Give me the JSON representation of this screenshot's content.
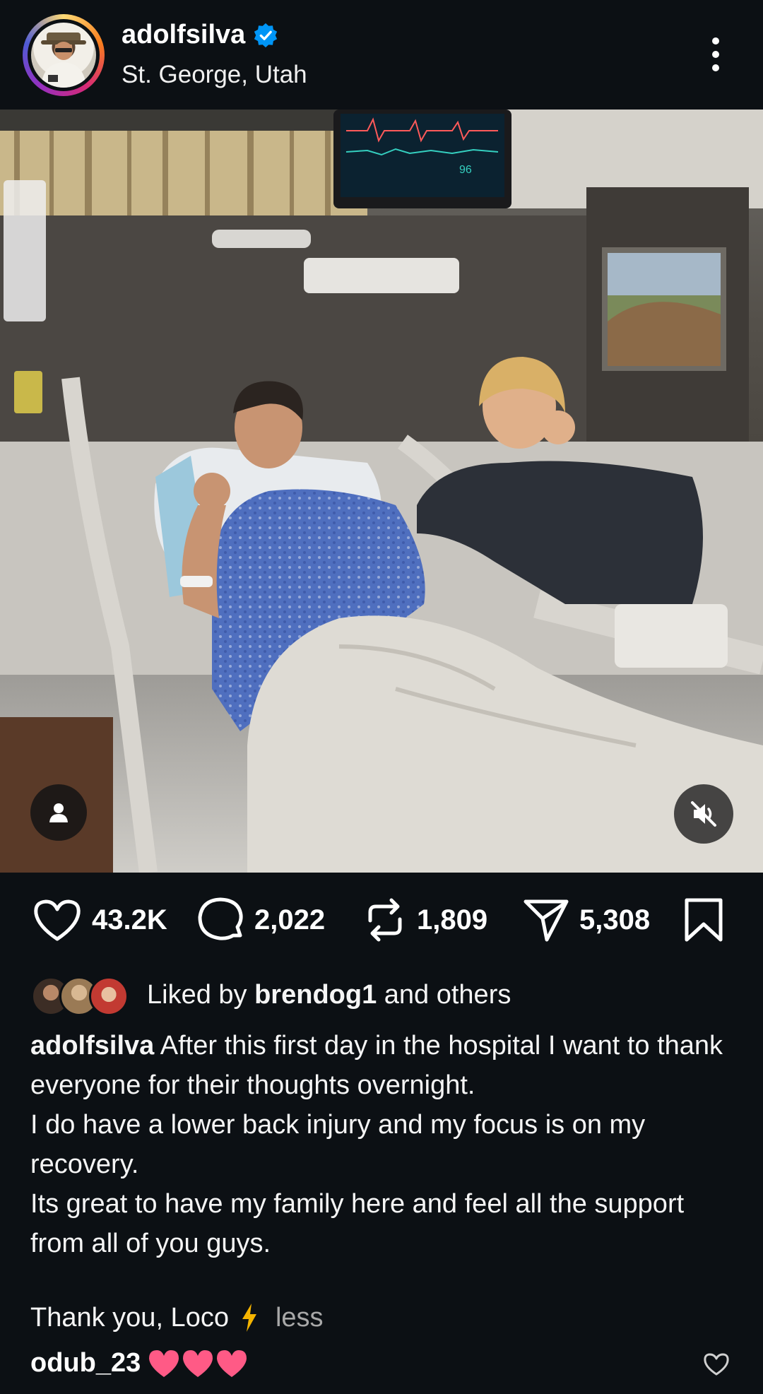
{
  "post": {
    "username": "adolfsilva",
    "location": "St. George, Utah",
    "verified": true
  },
  "actions": {
    "likes": "43.2K",
    "comments": "2,022",
    "reposts": "1,809",
    "shares": "5,308"
  },
  "liked_by": {
    "prefix": "Liked by ",
    "user": "brendog1",
    "suffix": " and others"
  },
  "caption": {
    "username": "adolfsilva",
    "line1": "After this first day in the hospital I want to thank everyone for their thoughts overnight.",
    "line2": "I do have a lower back injury and my focus is on my recovery.",
    "line3": "Its great to have my family here and feel all the support from all of you guys.",
    "closing": "Thank you, Loco",
    "less_label": "less"
  },
  "comment": {
    "username": "odub_23"
  },
  "icons": {
    "like": "heart-icon",
    "comment": "comment-bubble-icon",
    "repost": "repost-icon",
    "share": "send-icon",
    "save": "bookmark-icon",
    "more": "more-vertical-icon",
    "tag": "user-tag-icon",
    "mute": "muted-speaker-icon"
  },
  "colors": {
    "background": "#0c1014",
    "verified": "#0095f6",
    "heart_emoji": "#ff4d6d",
    "secondary_text": "#a8a8a8"
  }
}
